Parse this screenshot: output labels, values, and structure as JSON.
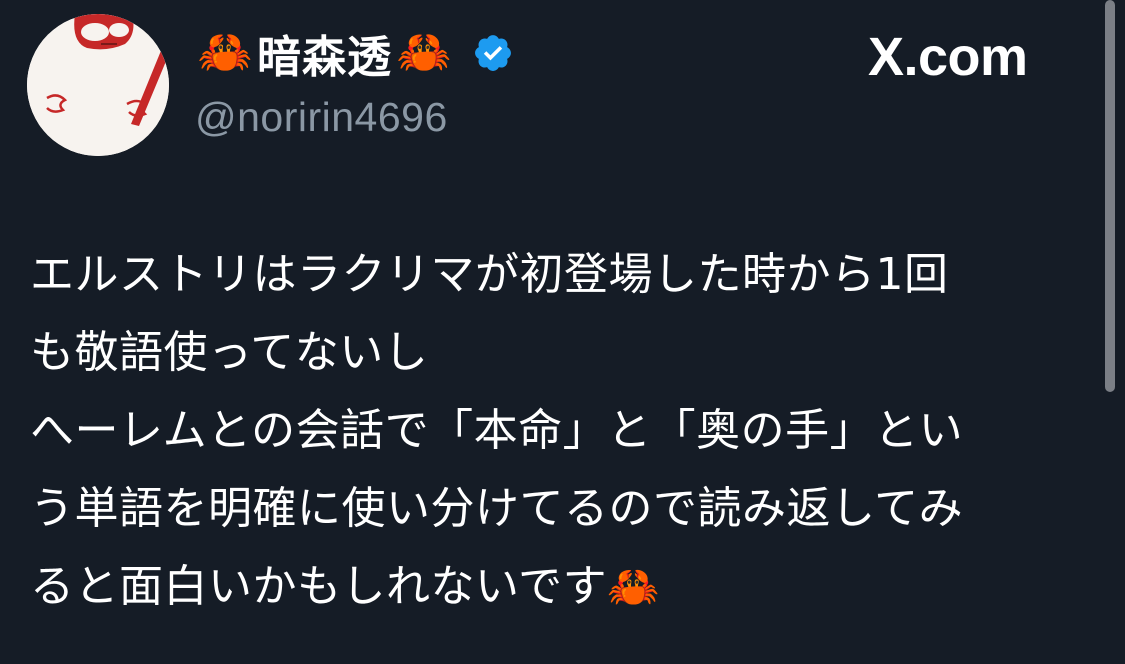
{
  "author": {
    "crab_left": "🦀",
    "display_name": "暗森透",
    "crab_right": "🦀",
    "handle": "@noririn4696",
    "verified_icon": "verified-badge-icon",
    "avatar_icon": "avatar-image"
  },
  "brand": {
    "label": "X.com"
  },
  "tweet": {
    "lines": [
      "エルストリはラクリマが初登場した時から1回",
      "も敬語使ってないし",
      "へーレムとの会話で「本命」と「奥の手」とい",
      "う単語を明確に使い分けてるので読み返してみ",
      "ると面白いかもしれないです"
    ],
    "trailing_emoji": "🦀"
  },
  "colors": {
    "background": "#151c26",
    "handle": "#8b98a5",
    "verified": "#1d9bf0",
    "text": "#ffffff"
  }
}
